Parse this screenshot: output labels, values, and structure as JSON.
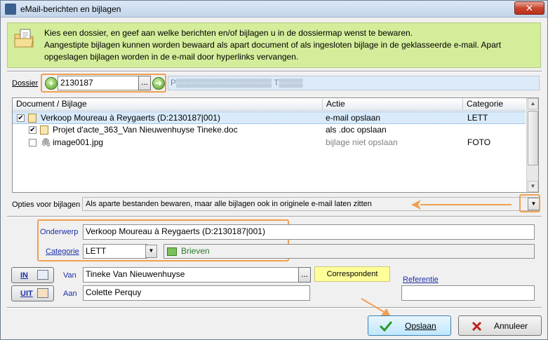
{
  "window": {
    "title": "eMail-berichten en bijlagen",
    "close_label": "✕"
  },
  "info": {
    "line1": "Kies een dossier, en geef aan welke berichten en/of bijlagen u in de dossiermap wenst te bewaren.",
    "line2": "Aangestipte bijlagen kunnen worden bewaard als apart document of als ingesloten bijlage in de geklasseerde e-mail. Apart",
    "line3": "opgeslagen bijlagen worden in de e-mail door hyperlinks vervangen."
  },
  "dossier": {
    "label": "Dossier",
    "value": "2130187",
    "ellipsis": "...",
    "name_value": "P▒▒▒▒▒▒▒▒▒▒▒▒▒▒▒▒ T▒▒▒▒"
  },
  "tree": {
    "columns": [
      "Document / Bijlage",
      "Actie",
      "Categorie"
    ],
    "rows": [
      {
        "document": "Verkoop Moureau à Reygaerts (D:2130187|001)",
        "action": "e-mail opslaan",
        "category": "LETT",
        "checked": "✔"
      },
      {
        "document": "Projet d'acte_363_Van Nieuwenhuyse Tineke.doc",
        "action": "als .doc opslaan",
        "category": "",
        "checked": "✔"
      },
      {
        "document": "image001.jpg",
        "action": "bijlage niet opslaan",
        "category": "FOTO",
        "checked": ""
      }
    ]
  },
  "options": {
    "label": "Opties voor bijlagen",
    "value": "Als aparte bestanden bewaren, maar alle bijlagen ook in originele e-mail laten zitten"
  },
  "subject": {
    "label": "Onderwerp",
    "value": "Verkoop Moureau à Reygaerts (D:2130187|001)"
  },
  "category": {
    "label": "Categorie",
    "value": "LETT",
    "linked": "Brieven"
  },
  "direction": {
    "in_label": "IN",
    "out_label": "UIT"
  },
  "from": {
    "label": "Van",
    "value": "Tineke Van Nieuwenhuyse",
    "ellipsis": "..."
  },
  "to": {
    "label": "Aan",
    "value": "Colette Perquy"
  },
  "correspondent_label": "Correspondent",
  "reference": {
    "label": "Referentie",
    "value": ""
  },
  "buttons": {
    "save": "Opslaan",
    "cancel": "Annuleer"
  },
  "colors": {
    "info_bg": "#d4ed9a",
    "highlight": "#f0a050",
    "accent_blue": "#1c2fa8",
    "correspondent_bg": "#ffff99"
  }
}
